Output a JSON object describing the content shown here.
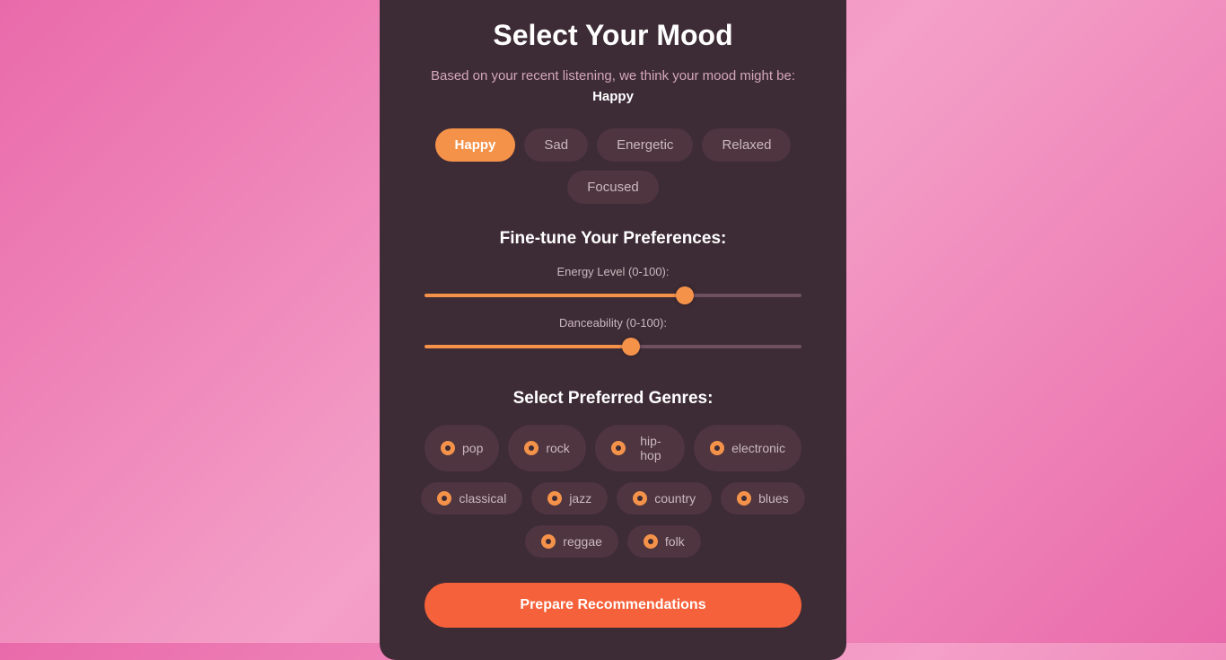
{
  "page": {
    "title": "Select Your Mood",
    "subtitle": "Based on your recent listening, we think your mood might be:",
    "detected_mood": "Happy"
  },
  "moods": [
    {
      "label": "Happy",
      "active": true
    },
    {
      "label": "Sad",
      "active": false
    },
    {
      "label": "Energetic",
      "active": false
    },
    {
      "label": "Relaxed",
      "active": false
    },
    {
      "label": "Focused",
      "active": false
    }
  ],
  "preferences": {
    "title": "Fine-tune Your Preferences:",
    "energy": {
      "label": "Energy Level (0-100):",
      "value": 70,
      "min": 0,
      "max": 100
    },
    "danceability": {
      "label": "Danceability (0-100):",
      "value": 55,
      "min": 0,
      "max": 100
    }
  },
  "genres": {
    "title": "Select Preferred Genres:",
    "items": [
      {
        "label": "pop"
      },
      {
        "label": "rock"
      },
      {
        "label": "hip-hop"
      },
      {
        "label": "electronic"
      },
      {
        "label": "classical"
      },
      {
        "label": "jazz"
      },
      {
        "label": "country"
      },
      {
        "label": "blues"
      },
      {
        "label": "reggae"
      },
      {
        "label": "folk"
      }
    ]
  },
  "cta": {
    "label": "Prepare Recommendations"
  }
}
